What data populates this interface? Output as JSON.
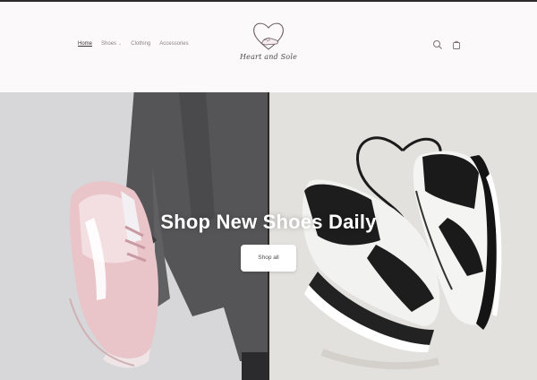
{
  "header": {
    "nav": [
      {
        "label": "Home",
        "active": true,
        "has_dropdown": false
      },
      {
        "label": "Shoes",
        "active": false,
        "has_dropdown": true
      },
      {
        "label": "Clothing",
        "active": false,
        "has_dropdown": false
      },
      {
        "label": "Accessories",
        "active": false,
        "has_dropdown": false
      }
    ],
    "logo_text": "Heart and Sole",
    "icons": [
      "search-icon",
      "cart-icon"
    ]
  },
  "hero": {
    "title": "Shop New Shoes Daily",
    "cta_label": "Shop all"
  },
  "colors": {
    "header_bg": "#fcf9fa",
    "nav_text": "#8a7f86",
    "hero_title": "#ffffff",
    "cta_bg": "#ffffff"
  }
}
